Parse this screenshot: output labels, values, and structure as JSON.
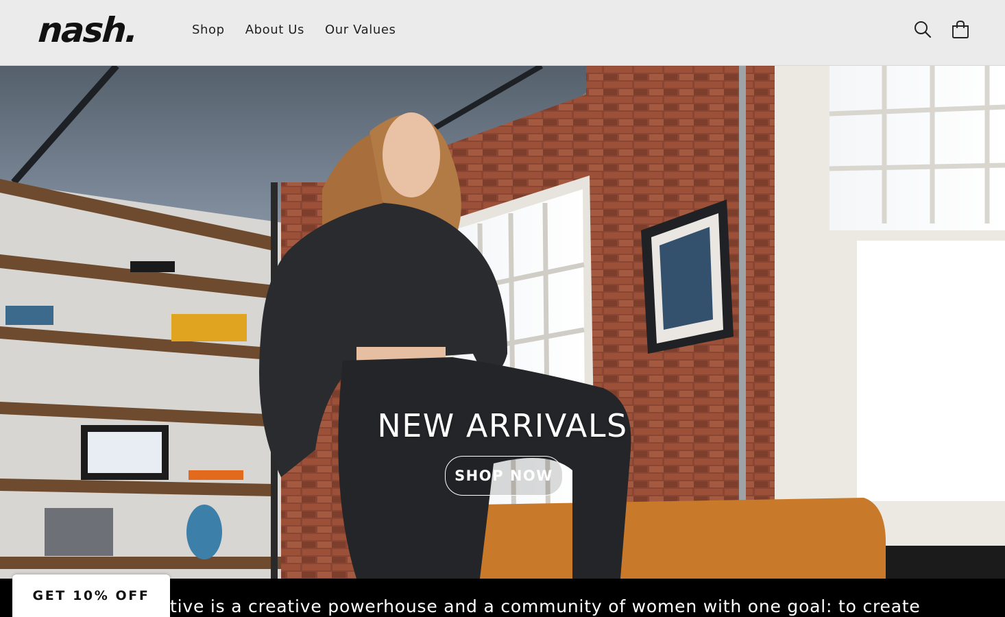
{
  "header": {
    "logo": "nash.",
    "nav": [
      {
        "label": "Shop"
      },
      {
        "label": "About Us"
      },
      {
        "label": "Our Values"
      }
    ],
    "icons": {
      "search": "search-icon",
      "cart": "cart-icon"
    }
  },
  "hero": {
    "title": "NEW ARRIVALS",
    "cta_label": "SHOP NOW"
  },
  "band": {
    "text": "tive is a creative powerhouse and a community of women with one goal: to create"
  },
  "popup": {
    "discount_label": "GET 10% OFF"
  },
  "colors": {
    "header_bg": "#ecebeb",
    "band_bg": "#000000",
    "brick": "#8b4a35"
  }
}
